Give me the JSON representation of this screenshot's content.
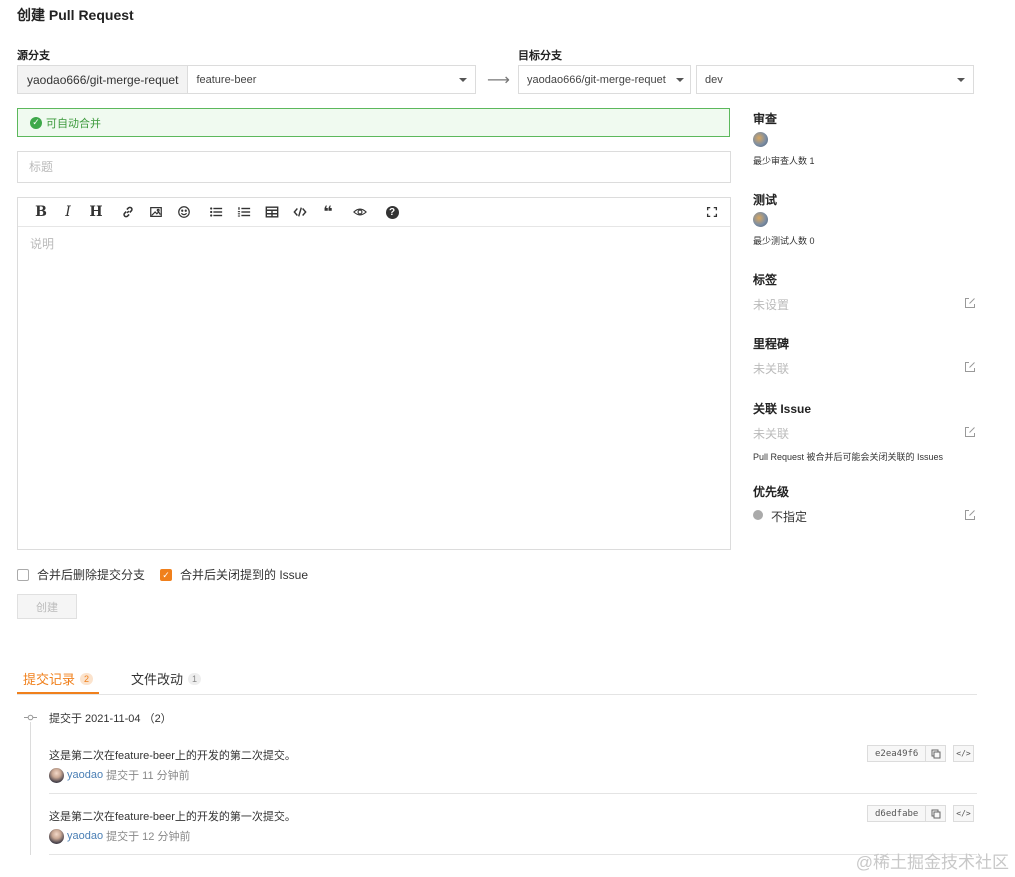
{
  "page_title": "创建 Pull Request",
  "source": {
    "label": "源分支",
    "repo": "yaodao666/git-merge-requet",
    "branch": "feature-beer"
  },
  "arrow": "⟶",
  "target": {
    "label": "目标分支",
    "repo": "yaodao666/git-merge-requet",
    "branch": "dev"
  },
  "merge_status": "可自动合并",
  "title_placeholder": "标题",
  "description_placeholder": "说明",
  "toolbar_glyphs": {
    "bold": "B",
    "italic": "I",
    "heading": "H",
    "quote": "❝",
    "help": "?"
  },
  "options": {
    "delete_branch": {
      "label": "合并后删除提交分支",
      "checked": false
    },
    "close_issue": {
      "label": "合并后关闭提到的 Issue",
      "checked": true
    }
  },
  "create_button": "创建",
  "sidebar": {
    "review": {
      "label": "审查",
      "note": "最少审查人数 1"
    },
    "test": {
      "label": "测试",
      "note": "最少测试人数 0"
    },
    "tags": {
      "label": "标签",
      "value": "未设置"
    },
    "milestone": {
      "label": "里程碑",
      "value": "未关联"
    },
    "issue": {
      "label": "关联 Issue",
      "value": "未关联",
      "note": "Pull Request 被合并后可能会关闭关联的 Issues"
    },
    "priority": {
      "label": "优先级",
      "value": "不指定"
    }
  },
  "tabs": [
    {
      "label": "提交记录",
      "count": "2",
      "active": true
    },
    {
      "label": "文件改动",
      "count": "1",
      "active": false
    }
  ],
  "commit_group": {
    "header": "提交于 2021-11-04 （2）"
  },
  "commits": [
    {
      "message": "这是第二次在feature-beer上的开发的第二次提交。",
      "author": "yaodao",
      "time": "提交于 11 分钟前",
      "sha": "e2ea49f6",
      "code_label": "</>"
    },
    {
      "message": "这是第二次在feature-beer上的开发的第一次提交。",
      "author": "yaodao",
      "time": "提交于 12 分钟前",
      "sha": "d6edfabe",
      "code_label": "</>"
    }
  ],
  "watermark": "@稀土掘金技术社区",
  "colors": {
    "accent": "#f0801c",
    "success": "#3ea84a",
    "link": "#4a7fb5"
  }
}
